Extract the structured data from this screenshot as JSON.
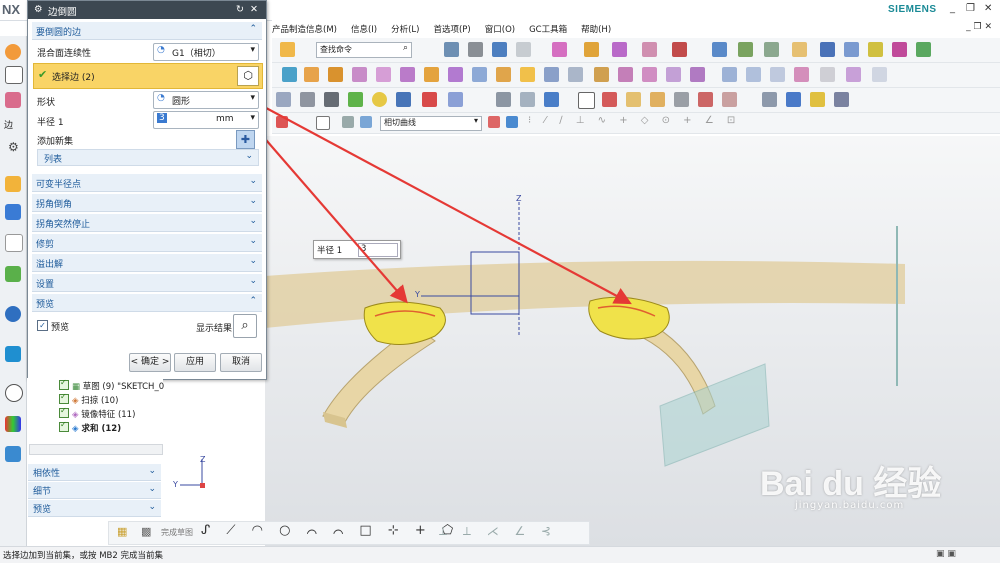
{
  "app": {
    "logo": "NX",
    "brand": "SIEMENS"
  },
  "menubar": [
    "产品制造信息(M)",
    "信息(I)",
    "分析(L)",
    "首选项(P)",
    "窗口(O)",
    "GC工具箱",
    "帮助(H)"
  ],
  "toolbar": {
    "command_search_placeholder": "查找命令",
    "curve_rule": "相切曲线"
  },
  "dialog": {
    "title": "边倒圆",
    "section_edges": "要倒圆的边",
    "blend_continuity_label": "混合面连续性",
    "blend_continuity_value": "G1（相切）",
    "select_edge_label": "选择边 (2)",
    "shape_label": "形状",
    "shape_value": "圆形",
    "radius_label": "半径 1",
    "radius_value": "3",
    "radius_unit": "mm",
    "add_new_set": "添加新集",
    "list_label": "列表",
    "collapsed_sections": [
      "可变半径点",
      "拐角倒角",
      "拐角突然停止",
      "修剪",
      "溢出解",
      "设置"
    ],
    "preview_section": "预览",
    "preview_checkbox": "预览",
    "show_result": "显示结果",
    "ok": "< 确定 >",
    "apply": "应用",
    "cancel": "取消"
  },
  "navigator": {
    "tree": [
      "草图 (9) \"SKETCH_0",
      "扫掠 (10)",
      "镜像特征 (11)",
      "求和 (12)"
    ],
    "sections": [
      "相依性",
      "细节",
      "预览"
    ]
  },
  "viewport": {
    "radius_callout_label": "半径 1",
    "radius_callout_value": "3",
    "axis_z": "Z",
    "axis_y": "Y",
    "triad_z": "Z",
    "triad_y": "Y"
  },
  "sketchbar": {
    "finish_label": "完成草图"
  },
  "status": "选择边加到当前集，或按 MB2 完成当前集",
  "watermark": {
    "text": "Bai du 经验",
    "sub": "jingyan.baidu.com"
  },
  "colors": {
    "accent": "#1d5a9a",
    "selection": "#f9d466",
    "arrow": "#e53935",
    "part": "#e2d2a8",
    "edge_fill": "#f0e24a"
  }
}
